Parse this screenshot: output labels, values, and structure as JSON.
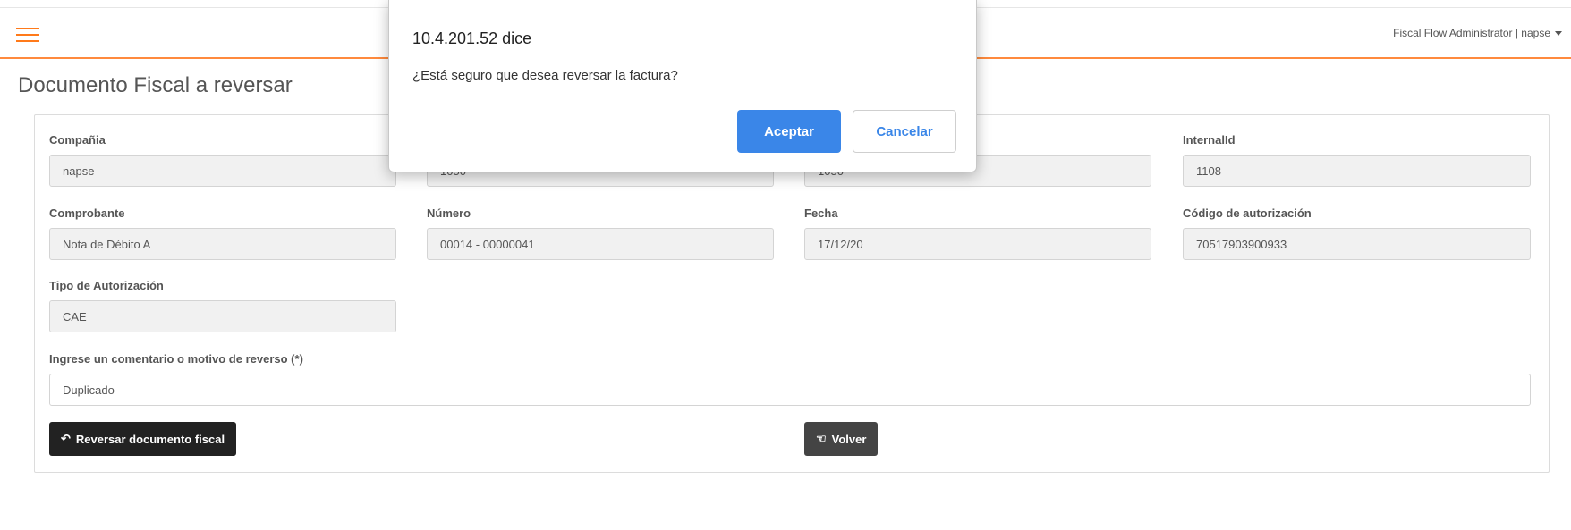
{
  "header": {
    "user_label": "Fiscal Flow Administrator | napse"
  },
  "page": {
    "title": "Documento Fiscal a reversar"
  },
  "form": {
    "compania": {
      "label": "Compañia",
      "value": "napse"
    },
    "field2": {
      "value": "1050"
    },
    "field3": {
      "value": "1050"
    },
    "internal_id": {
      "label": "InternalId",
      "value": "1108"
    },
    "comprobante": {
      "label": "Comprobante",
      "value": "Nota de Débito A"
    },
    "numero": {
      "label": "Número",
      "value": "00014 - 00000041"
    },
    "fecha": {
      "label": "Fecha",
      "value": "17/12/20"
    },
    "codigo_autorizacion": {
      "label": "Código de autorización",
      "value": "70517903900933"
    },
    "tipo_autorizacion": {
      "label": "Tipo de Autorización",
      "value": "CAE"
    },
    "comentario": {
      "label": "Ingrese un comentario o motivo de reverso (*)",
      "value": "Duplicado"
    }
  },
  "actions": {
    "reverse_label": "Reversar documento fiscal",
    "back_label": "Volver"
  },
  "dialog": {
    "title": "10.4.201.52 dice",
    "message": "¿Está seguro que desea reversar la factura?",
    "accept_label": "Aceptar",
    "cancel_label": "Cancelar"
  },
  "colors": {
    "accent": "#ff7a1a",
    "primary_button": "#3a86e8",
    "dark_button": "#222222"
  },
  "icons": {
    "menu": "hamburger-icon",
    "user_dropdown": "caret-down-icon",
    "reverse": "reply-arrow-icon",
    "back": "hand-point-left-icon"
  }
}
